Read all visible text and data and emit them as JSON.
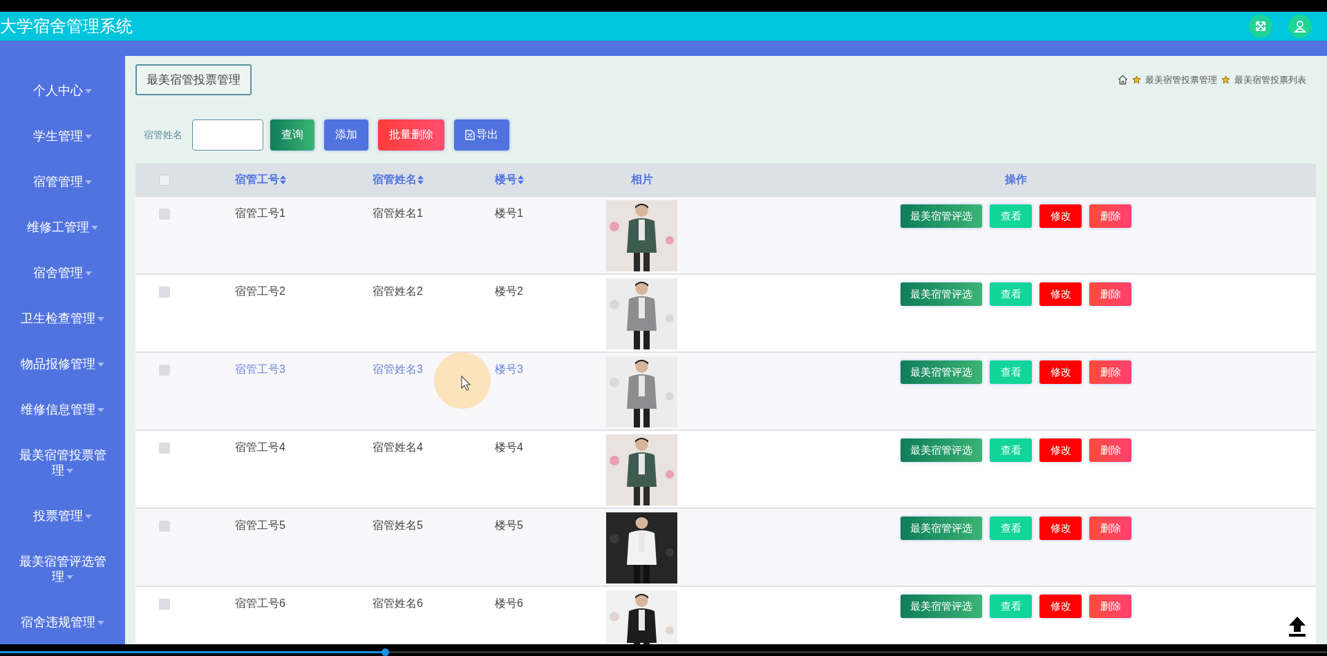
{
  "header": {
    "title": "大学宿舍管理系统"
  },
  "sidebar": {
    "items": [
      {
        "label": "个人中心"
      },
      {
        "label": "学生管理"
      },
      {
        "label": "宿管管理"
      },
      {
        "label": "维修工管理"
      },
      {
        "label": "宿舍管理"
      },
      {
        "label": "卫生检查管理"
      },
      {
        "label": "物品报修管理"
      },
      {
        "label": "维修信息管理"
      },
      {
        "label": "最美宿管投票管理"
      },
      {
        "label": "投票管理"
      },
      {
        "label": "最美宿管评选管理"
      },
      {
        "label": "宿舍违规管理"
      }
    ]
  },
  "page_title": "最美宿管投票管理",
  "breadcrumb": [
    "最美宿管投票管理",
    "最美宿管投票列表"
  ],
  "search": {
    "label": "宿管姓名"
  },
  "toolbar": [
    {
      "label": "查询",
      "kind": "search"
    },
    {
      "label": "添加",
      "kind": "add"
    },
    {
      "label": "批量删除",
      "kind": "batch-delete"
    },
    {
      "label": "导出",
      "kind": "export"
    }
  ],
  "table": {
    "select_all_checked": false,
    "columns": [
      {
        "label": "宿管工号",
        "sortable": true
      },
      {
        "label": "宿管姓名",
        "sortable": true
      },
      {
        "label": "楼号",
        "sortable": true
      },
      {
        "label": "相片",
        "sortable": false
      },
      {
        "label": "操作",
        "sortable": false
      }
    ],
    "rows": [
      {
        "staff_no": "宿管工号1",
        "name": "宿管姓名1",
        "building": "楼号1",
        "checked": false,
        "hovered": false,
        "actions": [
          {
            "label": "最美宿管评选",
            "kind": "elect"
          },
          {
            "label": "查看",
            "kind": "view"
          },
          {
            "label": "修改",
            "kind": "edit"
          },
          {
            "label": "删除",
            "kind": "delete"
          }
        ]
      },
      {
        "staff_no": "宿管工号2",
        "name": "宿管姓名2",
        "building": "楼号2",
        "checked": false,
        "hovered": false,
        "actions": [
          {
            "label": "最美宿管评选",
            "kind": "elect"
          },
          {
            "label": "查看",
            "kind": "view"
          },
          {
            "label": "修改",
            "kind": "edit"
          },
          {
            "label": "删除",
            "kind": "delete"
          }
        ]
      },
      {
        "staff_no": "宿管工号3",
        "name": "宿管姓名3",
        "building": "楼号3",
        "checked": false,
        "hovered": true,
        "actions": [
          {
            "label": "最美宿管评选",
            "kind": "elect"
          },
          {
            "label": "查看",
            "kind": "view"
          },
          {
            "label": "修改",
            "kind": "edit"
          },
          {
            "label": "删除",
            "kind": "delete"
          }
        ]
      },
      {
        "staff_no": "宿管工号4",
        "name": "宿管姓名4",
        "building": "楼号4",
        "checked": false,
        "hovered": false,
        "actions": [
          {
            "label": "最美宿管评选",
            "kind": "elect"
          },
          {
            "label": "查看",
            "kind": "view"
          },
          {
            "label": "修改",
            "kind": "edit"
          },
          {
            "label": "删除",
            "kind": "delete"
          }
        ]
      },
      {
        "staff_no": "宿管工号5",
        "name": "宿管姓名5",
        "building": "楼号5",
        "checked": false,
        "hovered": false,
        "actions": [
          {
            "label": "最美宿管评选",
            "kind": "elect"
          },
          {
            "label": "查看",
            "kind": "view"
          },
          {
            "label": "修改",
            "kind": "edit"
          },
          {
            "label": "删除",
            "kind": "delete"
          }
        ]
      },
      {
        "staff_no": "宿管工号6",
        "name": "宿管姓名6",
        "building": "楼号6",
        "checked": false,
        "hovered": false,
        "actions": [
          {
            "label": "最美宿管评选",
            "kind": "elect"
          },
          {
            "label": "查看",
            "kind": "view"
          },
          {
            "label": "修改",
            "kind": "edit"
          },
          {
            "label": "删除",
            "kind": "delete"
          }
        ]
      }
    ]
  },
  "pointer": {
    "visible": true
  },
  "video_progress": {
    "level": 0.29
  }
}
